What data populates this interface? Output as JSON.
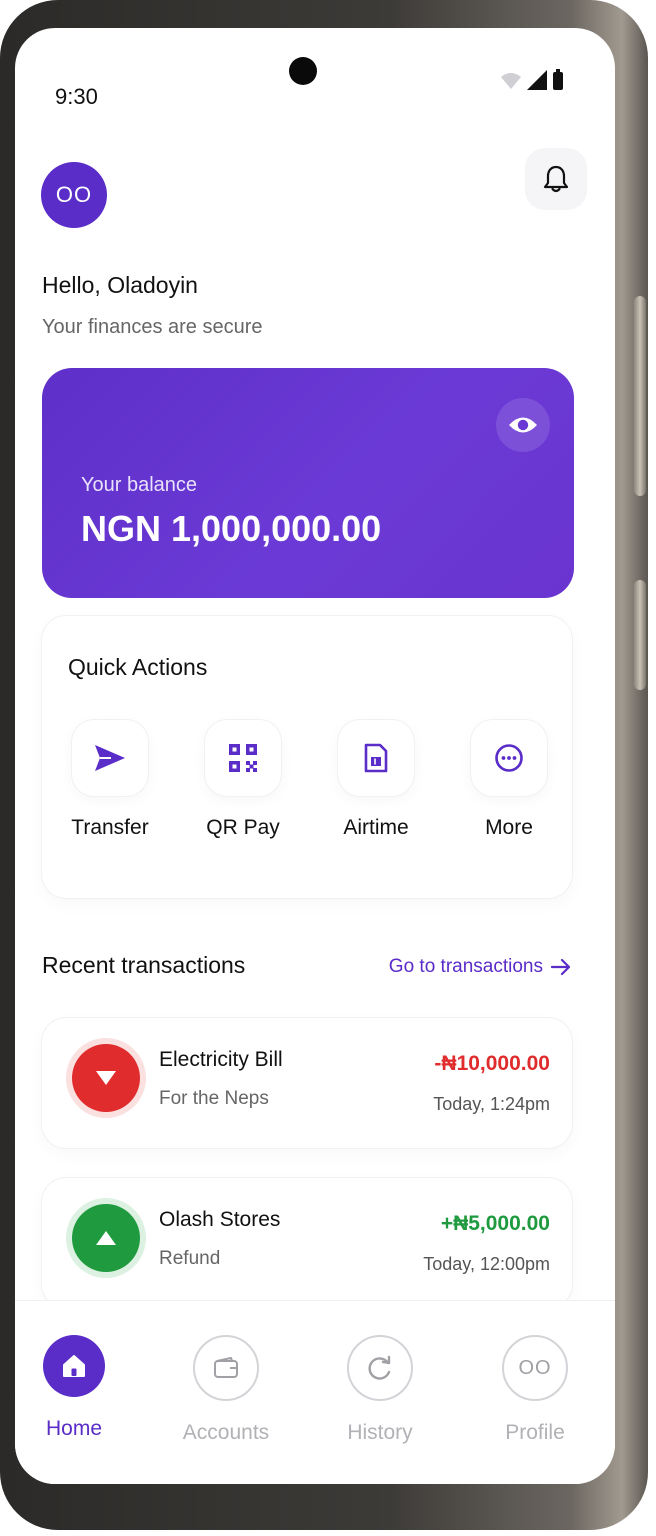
{
  "status_bar": {
    "time": "9:30"
  },
  "header": {
    "avatar_initials": "OO",
    "notifications_icon": "bell-icon"
  },
  "greeting": {
    "title": "Hello, Oladoyin",
    "subtitle": "Your finances are secure"
  },
  "balance": {
    "label": "Your balance",
    "amount": "NGN 1,000,000.00",
    "visibility_icon": "eye-icon"
  },
  "quick_actions": {
    "title": "Quick Actions",
    "items": [
      {
        "label": "Transfer",
        "icon": "send-icon"
      },
      {
        "label": "QR Pay",
        "icon": "qr-code-icon"
      },
      {
        "label": "Airtime",
        "icon": "sim-card-icon"
      },
      {
        "label": "More",
        "icon": "more-icon"
      }
    ]
  },
  "recent": {
    "title": "Recent transactions",
    "link_label": "Go to transactions",
    "transactions": [
      {
        "name": "Electricity Bill",
        "note": "For the Neps",
        "amount": "-₦10,000.00",
        "time": "Today, 1:24pm",
        "direction": "debit",
        "color": "#e02c2c"
      },
      {
        "name": "Olash Stores",
        "note": "Refund",
        "amount": "+₦5,000.00",
        "time": "Today, 12:00pm",
        "direction": "credit",
        "color": "#1f9a3f"
      }
    ]
  },
  "bottom_nav": {
    "items": [
      {
        "label": "Home",
        "icon": "home-icon",
        "active": true
      },
      {
        "label": "Accounts",
        "icon": "wallet-icon",
        "active": false
      },
      {
        "label": "History",
        "icon": "refresh-icon",
        "active": false
      },
      {
        "label": "Profile",
        "icon": "profile-avatar",
        "active": false,
        "initials": "OO"
      }
    ]
  },
  "colors": {
    "brand": "#5a2cc8",
    "debit": "#e02c2c",
    "credit": "#1f9a3f"
  }
}
